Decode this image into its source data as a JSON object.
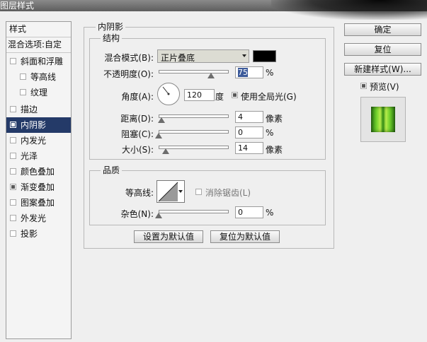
{
  "window": {
    "title": "图层样式"
  },
  "style_list": {
    "header": "样式",
    "blend_options": "混合选项:自定",
    "items": [
      {
        "label": "斜面和浮雕",
        "checked": false,
        "indent": false,
        "selected": false
      },
      {
        "label": "等高线",
        "checked": false,
        "indent": true,
        "selected": false
      },
      {
        "label": "纹理",
        "checked": false,
        "indent": true,
        "selected": false
      },
      {
        "label": "描边",
        "checked": false,
        "indent": false,
        "selected": false
      },
      {
        "label": "内阴影",
        "checked": true,
        "indent": false,
        "selected": true
      },
      {
        "label": "内发光",
        "checked": false,
        "indent": false,
        "selected": false
      },
      {
        "label": "光泽",
        "checked": false,
        "indent": false,
        "selected": false
      },
      {
        "label": "颜色叠加",
        "checked": false,
        "indent": false,
        "selected": false
      },
      {
        "label": "渐变叠加",
        "checked": true,
        "indent": false,
        "selected": false
      },
      {
        "label": "图案叠加",
        "checked": false,
        "indent": false,
        "selected": false
      },
      {
        "label": "外发光",
        "checked": false,
        "indent": false,
        "selected": false
      },
      {
        "label": "投影",
        "checked": false,
        "indent": false,
        "selected": false
      }
    ]
  },
  "panel": {
    "title": "内阴影",
    "structure": {
      "title": "结构",
      "blend_mode_label": "混合模式(B):",
      "blend_mode_value": "正片叠底",
      "shadow_color": "#000000",
      "opacity_label": "不透明度(O):",
      "opacity_value": "75",
      "opacity_unit": "%",
      "angle_label": "角度(A):",
      "angle_value": "120",
      "angle_unit": "度",
      "global_light_label": "使用全局光(G)",
      "global_light_checked": true,
      "distance_label": "距离(D):",
      "distance_value": "4",
      "distance_unit": "像素",
      "choke_label": "阻塞(C):",
      "choke_value": "0",
      "choke_unit": "%",
      "size_label": "大小(S):",
      "size_value": "14",
      "size_unit": "像素"
    },
    "quality": {
      "title": "品质",
      "contour_label": "等高线:",
      "anti_alias_label": "消除锯齿(L)",
      "anti_alias_checked": false,
      "noise_label": "杂色(N):",
      "noise_value": "0",
      "noise_unit": "%"
    },
    "make_default": "设置为默认值",
    "reset_default": "复位为默认值"
  },
  "right": {
    "ok": "确定",
    "reset": "复位",
    "new_style": "新建样式(W)...",
    "preview_label": "预览(V)",
    "preview_checked": true
  },
  "colors": {
    "selection": "#243a68",
    "preview_green": "#5cb82a"
  }
}
